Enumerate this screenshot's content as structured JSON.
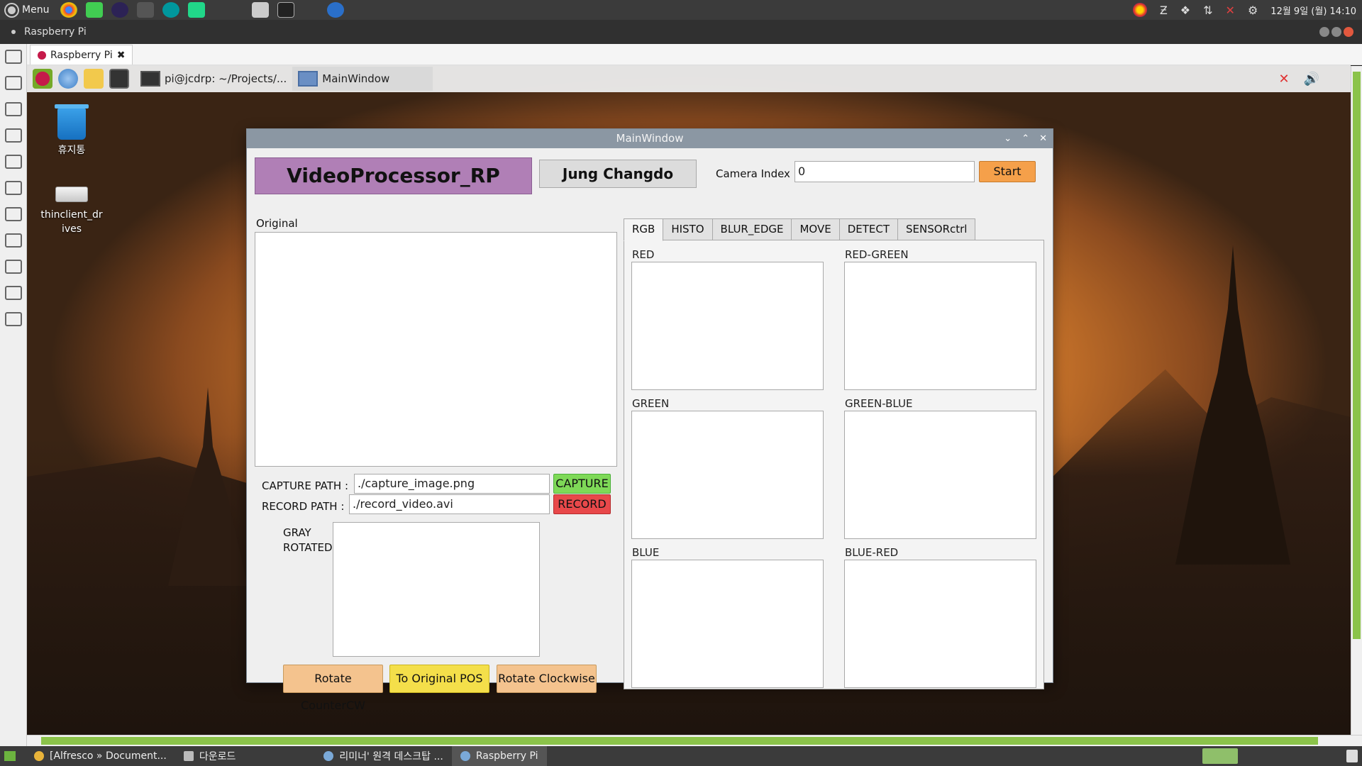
{
  "host": {
    "menu_label": "Menu",
    "tray_datetime": "12월 9일 (월) 14:10",
    "taskbar": [
      {
        "label": "[Alfresco » Document..."
      },
      {
        "label": "다운로드"
      },
      {
        "label": "리미너' 원격 데스크탑 ..."
      },
      {
        "label": "Raspberry Pi"
      }
    ]
  },
  "remote": {
    "window_title": "Raspberry Pi",
    "tab_label": "Raspberry Pi",
    "tab_close": "✖"
  },
  "pi": {
    "taskbar_items": [
      {
        "label": "pi@jcdrp: ~/Projects/..."
      },
      {
        "label": "MainWindow"
      }
    ],
    "desktop_icons": [
      {
        "label": "휴지통"
      },
      {
        "label": "thinclient_drives"
      }
    ]
  },
  "app": {
    "window_title": "MainWindow",
    "title_label": "VideoProcessor_RP",
    "author_label": "Jung Changdo",
    "camera_index_label": "Camera Index :",
    "camera_index_value": "0",
    "start_button": "Start",
    "original_label": "Original",
    "capture_path_label": "CAPTURE PATH :",
    "capture_path_value": "./capture_image.png",
    "capture_button": "CAPTURE",
    "record_path_label": "RECORD PATH :",
    "record_path_value": "./record_video.avi",
    "record_button": "RECORD",
    "gray_label": "GRAY",
    "rotated_label": "ROTATED",
    "rotate_ccw_button": "Rotate CounterCW",
    "to_original_button": "To Original POS",
    "rotate_cw_button": "Rotate Clockwise",
    "tabs": [
      {
        "label": "RGB",
        "active": true
      },
      {
        "label": "HISTO"
      },
      {
        "label": "BLUR_EDGE"
      },
      {
        "label": "MOVE"
      },
      {
        "label": "DETECT"
      },
      {
        "label": "SENSORctrl"
      }
    ],
    "rgb_panes": [
      {
        "label": "RED"
      },
      {
        "label": "RED-GREEN"
      },
      {
        "label": "GREEN"
      },
      {
        "label": "GREEN-BLUE"
      },
      {
        "label": "BLUE"
      },
      {
        "label": "BLUE-RED"
      }
    ]
  },
  "colors": {
    "title_bg": "#b07fb6",
    "start_bg": "#f5a04a",
    "capture_bg": "#7ed957",
    "record_bg": "#e8484a",
    "rotate_bg": "#f4c38e",
    "to_original_bg": "#f4df4a"
  }
}
